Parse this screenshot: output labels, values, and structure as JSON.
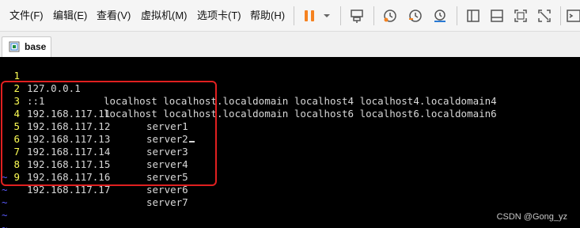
{
  "menu": {
    "file": "文件(F)",
    "edit": "编辑(E)",
    "view": "查看(V)",
    "vm": "虚拟机(M)",
    "tabs": "选项卡(T)",
    "help": "帮助(H)"
  },
  "toolbar": {
    "icons": [
      "pause-icon",
      "dropdown-icon",
      "send-keys-icon",
      "snapshot-icon",
      "revert-snapshot-icon",
      "snapshot-manager-icon",
      "sidebar-icon",
      "thumbnail-icon",
      "fullscreen-icon",
      "unity-icon",
      "console-icon"
    ],
    "accent": "#f58220"
  },
  "tab": {
    "label": "base"
  },
  "terminal": {
    "lines": [
      {
        "num": "1",
        "ip": "127.0.0.1",
        "rest": "localhost localhost.localdomain localhost4 localhost4.localdomain4"
      },
      {
        "num": "2",
        "ip": "::1",
        "rest": "localhost localhost.localdomain localhost6 localhost6.localdomain6"
      },
      {
        "num": "3",
        "ip": "192.168.117.11",
        "host": "server1"
      },
      {
        "num": "4",
        "ip": "192.168.117.12",
        "host": "server2"
      },
      {
        "num": "5",
        "ip": "192.168.117.13",
        "host": "server3"
      },
      {
        "num": "6",
        "ip": "192.168.117.14",
        "host": "server4"
      },
      {
        "num": "7",
        "ip": "192.168.117.15",
        "host": "server5"
      },
      {
        "num": "8",
        "ip": "192.168.117.16",
        "host": "server6"
      },
      {
        "num": "9",
        "ip": "192.168.117.17",
        "host": "server7"
      }
    ],
    "empty_marker": "~",
    "colors": {
      "background": "#000000",
      "text": "#d8d8d8",
      "line_number": "#ffff55",
      "tilde": "#5b5bff"
    }
  },
  "annotation": {
    "box_color": "#e02020"
  },
  "watermark": "CSDN @Gong_yz"
}
